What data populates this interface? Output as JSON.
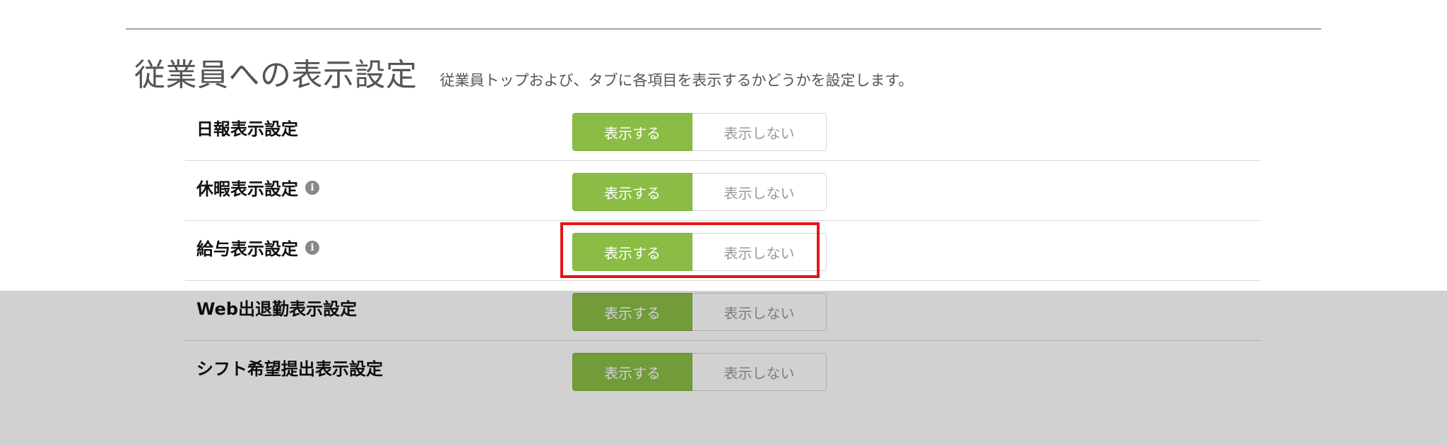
{
  "section": {
    "title": "従業員への表示設定",
    "description": "従業員トップおよび、タブに各項目を表示するかどうかを設定します。"
  },
  "rows": [
    {
      "label": "日報表示設定",
      "has_info_icon": false,
      "on_label": "表示する",
      "off_label": "表示しない",
      "selected": "on"
    },
    {
      "label": "休暇表示設定",
      "has_info_icon": true,
      "on_label": "表示する",
      "off_label": "表示しない",
      "selected": "on"
    },
    {
      "label": "給与表示設定",
      "has_info_icon": true,
      "on_label": "表示する",
      "off_label": "表示しない",
      "selected": "on"
    },
    {
      "label": "Web出退勤表示設定",
      "has_info_icon": false,
      "on_label": "表示する",
      "off_label": "表示しない",
      "selected": "on"
    },
    {
      "label": "シフト希望提出表示設定",
      "has_info_icon": false,
      "on_label": "表示する",
      "off_label": "表示しない",
      "selected": "on"
    }
  ],
  "info_icon_glyph": "i",
  "colors": {
    "toggle_active": "#8bbd46",
    "highlight": "#e3161b",
    "overlay": "rgba(0,0,0,0.18)"
  }
}
